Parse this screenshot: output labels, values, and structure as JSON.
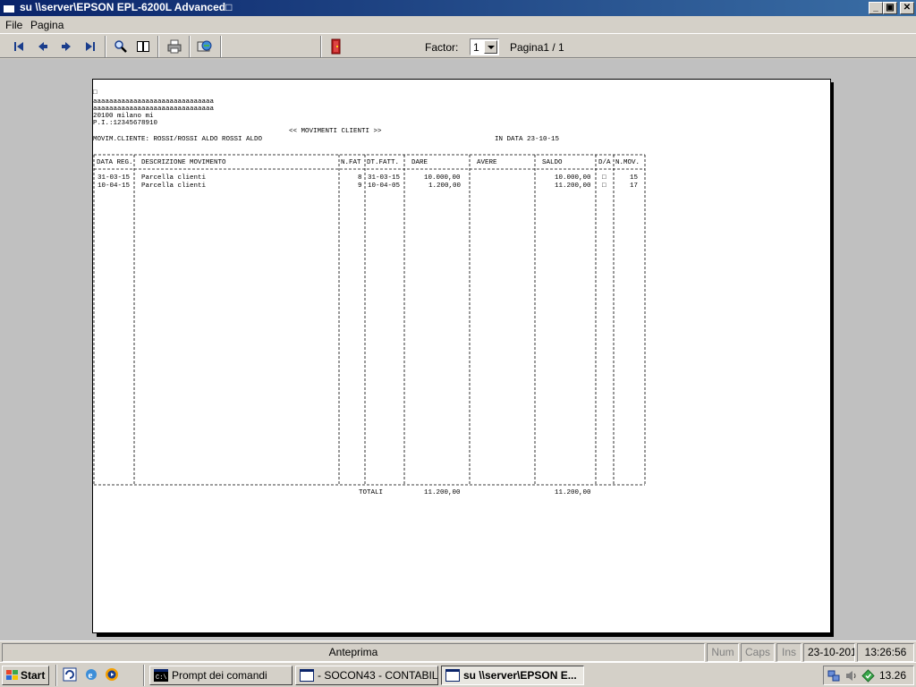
{
  "window": {
    "title": "su \\\\server\\EPSON EPL-6200L Advanced□",
    "minimize": "_",
    "maximize": "▣",
    "close": "✕"
  },
  "menu": {
    "file": "File",
    "pagina": "Pagina"
  },
  "toolbar": {
    "icons": [
      "first-page-icon",
      "previous-page-icon",
      "next-page-icon",
      "last-page-icon",
      "zoom-icon",
      "two-pages-icon",
      "print-icon",
      "send-icon",
      "exit-icon"
    ],
    "factor_label": "Factor:",
    "factor_value": "1",
    "page_label": "Pagina1 / 1"
  },
  "report": {
    "marker": "□",
    "header_lines": [
      "aaaaaaaaaaaaaaaaaaaaaaaaaaaaaa",
      "aaaaaaaaaaaaaaaaaaaaaaaaaaaaaa",
      "20100 milano mi",
      "P.I.:12345678910"
    ],
    "title": "<< MOVIMENTI CLIENTI >>",
    "client_line": "MOVIM.CLIENTE: ROSSI/ROSSI ALDO ROSSI ALDO",
    "date_line": "IN DATA 23-10-15",
    "columns": [
      "DATA REG.",
      "DESCRIZIONE MOVIMENTO",
      "N.FAT",
      "DT.FATT.",
      "DARE",
      "AVERE",
      "SALDO",
      "D/A",
      "N.MOV."
    ],
    "rows": [
      [
        "31-03-15",
        "Parcella clienti",
        "8",
        "31-03-15",
        "10.000,00",
        "",
        "10.000,00",
        "□",
        "15"
      ],
      [
        "10-04-15",
        "Parcella clienti",
        "9",
        "10-04-05",
        "1.200,00",
        "",
        "11.200,00",
        "□",
        "17"
      ]
    ],
    "totals_label": "TOTALI",
    "totals_dare": "11.200,00",
    "totals_saldo": "11.200,00"
  },
  "status": {
    "text": "Anteprima",
    "num": "Num",
    "caps": "Caps",
    "ins": "Ins",
    "date": "23-10-2015",
    "time": "13:26:56"
  },
  "taskbar": {
    "start": "Start",
    "quick_launch": [
      "ie-refresh-icon",
      "internet-explorer-icon",
      "media-player-icon"
    ],
    "tasks": [
      {
        "label": "Prompt dei comandi",
        "icon": "cmd-icon"
      },
      {
        "label": "- SOCON43 - CONTABILI...",
        "icon": "window-icon"
      },
      {
        "label": "su \\\\server\\EPSON E...",
        "icon": "window-icon"
      }
    ],
    "tray_icons": [
      "network-icon",
      "volume-icon",
      "security-icon"
    ],
    "clock": "13.26"
  }
}
